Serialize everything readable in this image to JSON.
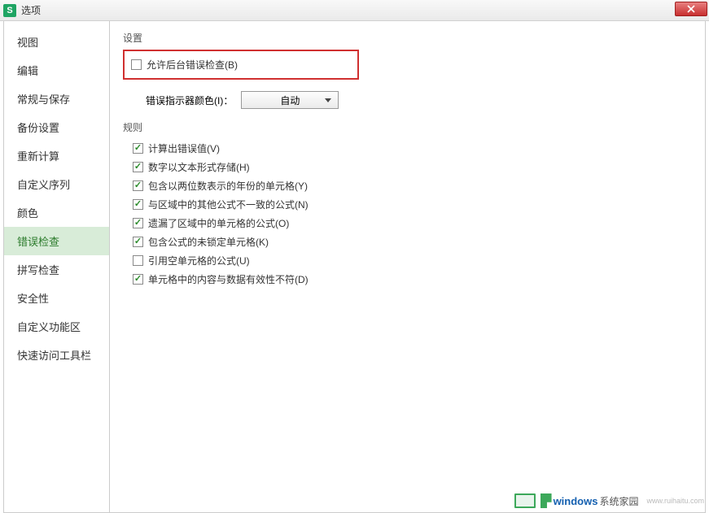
{
  "window": {
    "title": "选项",
    "app_icon_letter": "S"
  },
  "sidebar": {
    "items": [
      {
        "label": "视图"
      },
      {
        "label": "编辑"
      },
      {
        "label": "常规与保存"
      },
      {
        "label": "备份设置"
      },
      {
        "label": "重新计算"
      },
      {
        "label": "自定义序列"
      },
      {
        "label": "颜色"
      },
      {
        "label": "错误检查",
        "active": true
      },
      {
        "label": "拼写检查"
      },
      {
        "label": "安全性"
      },
      {
        "label": "自定义功能区"
      },
      {
        "label": "快速访问工具栏"
      }
    ]
  },
  "settings": {
    "section_label": "设置",
    "allow_bg_check": {
      "label": "允许后台错误检查(B)",
      "checked": false
    },
    "indicator_color_label": "错误指示器颜色(I)：",
    "indicator_color_value": "自动"
  },
  "rules": {
    "section_label": "规则",
    "items": [
      {
        "label": "计算出错误值(V)",
        "checked": true
      },
      {
        "label": "数字以文本形式存储(H)",
        "checked": true
      },
      {
        "label": "包含以两位数表示的年份的单元格(Y)",
        "checked": true
      },
      {
        "label": "与区域中的其他公式不一致的公式(N)",
        "checked": true
      },
      {
        "label": "遗漏了区域中的单元格的公式(O)",
        "checked": true
      },
      {
        "label": "包含公式的未锁定单元格(K)",
        "checked": true
      },
      {
        "label": "引用空单元格的公式(U)",
        "checked": false
      },
      {
        "label": "单元格中的内容与数据有效性不符(D)",
        "checked": true
      }
    ]
  },
  "watermark": {
    "text1": "windows",
    "text2": "系统家园",
    "url": "www.ruihaitu.com"
  }
}
